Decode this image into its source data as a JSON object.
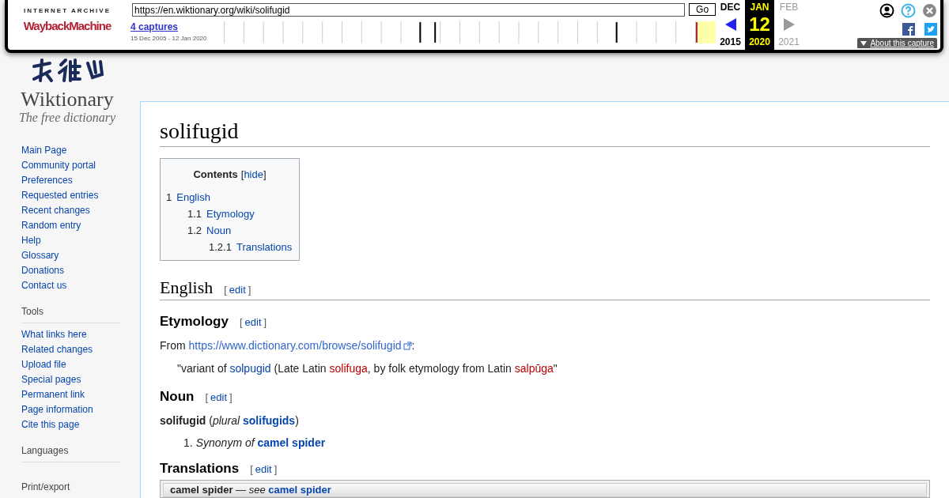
{
  "wayback": {
    "logo_top": "INTERNET ARCHIVE",
    "logo_main": "WaybackMachine",
    "url": "https://en.wiktionary.org/wiki/solifugid",
    "go": "Go",
    "captures": "4 captures",
    "range": "15 Dec 2005 - 12 Jan 2020",
    "months": [
      {
        "month": "DEC",
        "year": "2015",
        "selected": false,
        "enabled": true
      },
      {
        "month": "JAN",
        "day": "12",
        "year": "2020",
        "selected": true,
        "enabled": true
      },
      {
        "month": "FEB",
        "year": "2021",
        "selected": false,
        "enabled": false
      }
    ],
    "about": "About this capture"
  },
  "sidebar": {
    "logo_title": "Wiktionary",
    "logo_tagline": "The free dictionary",
    "navigation": [
      "Main Page",
      "Community portal",
      "Preferences",
      "Requested entries",
      "Recent changes",
      "Random entry",
      "Help",
      "Glossary",
      "Donations",
      "Contact us"
    ],
    "sections": [
      {
        "heading": "Tools",
        "items": [
          "What links here",
          "Related changes",
          "Upload file",
          "Special pages",
          "Permanent link",
          "Page information",
          "Cite this page"
        ]
      },
      {
        "heading": "Languages"
      },
      {
        "heading": "Print/export"
      }
    ]
  },
  "page": {
    "title": "solifugid",
    "toc": {
      "title": "Contents",
      "hide_open": "[",
      "hide": "hide",
      "hide_close": "]",
      "entries": [
        {
          "number": "1",
          "label": "English",
          "children": [
            {
              "number": "1.1",
              "label": "Etymology"
            },
            {
              "number": "1.2",
              "label": "Noun",
              "children": [
                {
                  "number": "1.2.1",
                  "label": "Translations"
                }
              ]
            }
          ]
        }
      ]
    },
    "language_heading": {
      "text": "English",
      "edit": {
        "open": "[",
        "label": "edit",
        "close": "]"
      }
    },
    "etymology_heading": {
      "text": "Etymology",
      "edit": {
        "open": "[",
        "label": "edit",
        "close": "]"
      }
    },
    "etymology_lines": [
      [
        {
          "kind": "text",
          "text": "From "
        },
        {
          "kind": "extlink",
          "text": "https://www.dictionary.com/browse/solifugid"
        },
        {
          "kind": "text",
          "text": ":"
        }
      ],
      [
        {
          "kind": "text",
          "text": "\"variant of "
        },
        {
          "kind": "link",
          "text": "solpugid"
        },
        {
          "kind": "text",
          "text": " (Late Latin "
        },
        {
          "kind": "redlink",
          "text": "solifuga"
        },
        {
          "kind": "text",
          "text": ", by folk etymology from Latin "
        },
        {
          "kind": "redlink",
          "text": "salpūga"
        },
        {
          "kind": "text",
          "text": "\""
        }
      ]
    ],
    "noun_heading": {
      "text": "Noun",
      "edit": {
        "open": "[",
        "label": "edit",
        "close": "]"
      }
    },
    "headword": [
      {
        "kind": "bold",
        "text": "solifugid"
      },
      {
        "kind": "text",
        "text": " ("
      },
      {
        "kind": "italic",
        "text": "plural "
      },
      {
        "kind": "boldlink",
        "text": "solifugids"
      },
      {
        "kind": "text",
        "text": ")"
      }
    ],
    "senses": [
      {
        "number": "1.",
        "parts": [
          {
            "kind": "italic",
            "text": "Synonym of "
          },
          {
            "kind": "boldlink",
            "text": "camel spider"
          }
        ]
      }
    ],
    "translations_heading": {
      "text": "Translations",
      "edit": {
        "open": "[",
        "label": "edit",
        "close": "]"
      }
    },
    "translation_rows": [
      [
        {
          "kind": "bold",
          "text": "camel spider"
        },
        {
          "kind": "text",
          "text": " — "
        },
        {
          "kind": "italic",
          "text": "see "
        },
        {
          "kind": "boldlink",
          "text": "camel spider"
        }
      ]
    ]
  }
}
